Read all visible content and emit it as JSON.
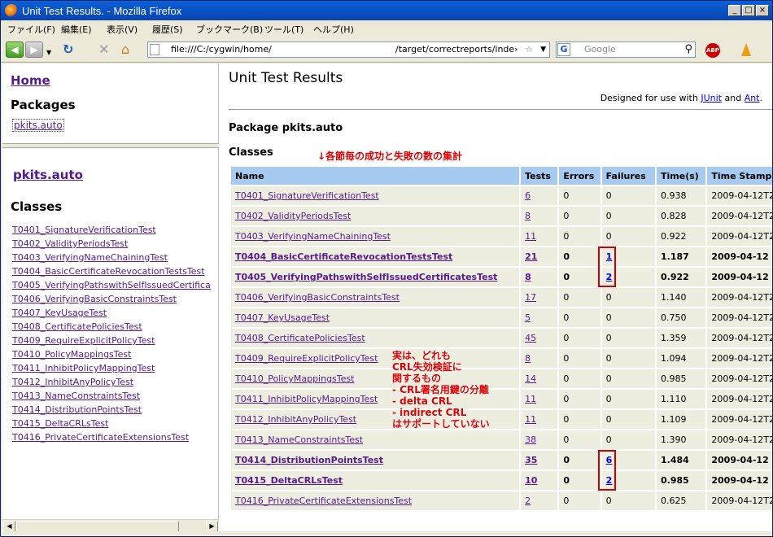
{
  "window": {
    "title": "Unit Test Results. - Mozilla Firefox"
  },
  "menu": [
    "ファイル(F)",
    "編集(E)",
    "表示(V)",
    "履歴(S)",
    "ブックマーク(B)",
    "ツール(T)",
    "ヘルプ(H)"
  ],
  "toolbar": {
    "url_part1": "file:///C:/cygwin/home/",
    "url_part2": "/target/correctreports/inde›",
    "search_placeholder": "Google",
    "addon_label": "ABP"
  },
  "left": {
    "home": "Home",
    "packages_heading": "Packages",
    "package_link": "pkits.auto",
    "package_title": "pkits.auto",
    "classes_heading": "Classes",
    "classes": [
      "T0401_SignatureVerificationTest",
      "T0402_ValidityPeriodsTest",
      "T0403_VerifyingNameChainingTest",
      "T0404_BasicCertificateRevocationTestsTest",
      "T0405_VerifyingPathswithSelfIssuedCertifica",
      "T0406_VerifyingBasicConstraintsTest",
      "T0407_KeyUsageTest",
      "T0408_CertificatePoliciesTest",
      "T0409_RequireExplicitPolicyTest",
      "T0410_PolicyMappingsTest",
      "T0411_InhibitPolicyMappingTest",
      "T0412_InhibitAnyPolicyTest",
      "T0413_NameConstraintsTest",
      "T0414_DistributionPointsTest",
      "T0415_DeltaCRLsTest",
      "T0416_PrivateCertificateExtensionsTest"
    ]
  },
  "main": {
    "title": "Unit Test Results",
    "designed_prefix": "Designed for use with ",
    "designed_junit": "JUnit",
    "designed_and": " and ",
    "designed_ant": "Ant",
    "designed_suffix": ".",
    "package_heading": "Package pkits.auto",
    "classes_heading": "Classes",
    "annotation_top": "↓各節毎の成功と失敗の数の集計",
    "annotation_note": [
      "実は、どれも",
      "CRL失効検証に",
      "関するもの",
      "- CRL署名用鍵の分離",
      "- delta CRL",
      "- indirect CRL",
      "はサポートしていない"
    ],
    "table": {
      "headers": [
        "Name",
        "Tests",
        "Errors",
        "Failures",
        "Time(s)",
        "Time Stamp"
      ],
      "rows": [
        {
          "name": "T0401_SignatureVerificationTest",
          "tests": "6",
          "errors": "0",
          "failures": "0",
          "time": "0.938",
          "stamp": "2009-04-12T2",
          "fail": false
        },
        {
          "name": "T0402_ValidityPeriodsTest",
          "tests": "8",
          "errors": "0",
          "failures": "0",
          "time": "0.828",
          "stamp": "2009-04-12T2",
          "fail": false
        },
        {
          "name": "T0403_VerifyingNameChainingTest",
          "tests": "11",
          "errors": "0",
          "failures": "0",
          "time": "0.922",
          "stamp": "2009-04-12T2",
          "fail": false
        },
        {
          "name": "T0404_BasicCertificateRevocationTestsTest",
          "tests": "21",
          "errors": "0",
          "failures": "1",
          "time": "1.187",
          "stamp": "2009-04-12",
          "fail": true
        },
        {
          "name": "T0405_VerifyingPathswithSelfIssuedCertificatesTest",
          "tests": "8",
          "errors": "0",
          "failures": "2",
          "time": "0.922",
          "stamp": "2009-04-12",
          "fail": true
        },
        {
          "name": "T0406_VerifyingBasicConstraintsTest",
          "tests": "17",
          "errors": "0",
          "failures": "0",
          "time": "1.140",
          "stamp": "2009-04-12T2",
          "fail": false
        },
        {
          "name": "T0407_KeyUsageTest",
          "tests": "5",
          "errors": "0",
          "failures": "0",
          "time": "0.750",
          "stamp": "2009-04-12T2",
          "fail": false
        },
        {
          "name": "T0408_CertificatePoliciesTest",
          "tests": "45",
          "errors": "0",
          "failures": "0",
          "time": "1.359",
          "stamp": "2009-04-12T2",
          "fail": false
        },
        {
          "name": "T0409_RequireExplicitPolicyTest",
          "tests": "8",
          "errors": "0",
          "failures": "0",
          "time": "1.094",
          "stamp": "2009-04-12T2",
          "fail": false
        },
        {
          "name": "T0410_PolicyMappingsTest",
          "tests": "14",
          "errors": "0",
          "failures": "0",
          "time": "0.985",
          "stamp": "2009-04-12T2",
          "fail": false
        },
        {
          "name": "T0411_InhibitPolicyMappingTest",
          "tests": "11",
          "errors": "0",
          "failures": "0",
          "time": "1.110",
          "stamp": "2009-04-12T2",
          "fail": false
        },
        {
          "name": "T0412_InhibitAnyPolicyTest",
          "tests": "11",
          "errors": "0",
          "failures": "0",
          "time": "1.109",
          "stamp": "2009-04-12T2",
          "fail": false
        },
        {
          "name": "T0413_NameConstraintsTest",
          "tests": "38",
          "errors": "0",
          "failures": "0",
          "time": "1.390",
          "stamp": "2009-04-12T2",
          "fail": false
        },
        {
          "name": "T0414_DistributionPointsTest",
          "tests": "35",
          "errors": "0",
          "failures": "6",
          "time": "1.484",
          "stamp": "2009-04-12",
          "fail": true
        },
        {
          "name": "T0415_DeltaCRLsTest",
          "tests": "10",
          "errors": "0",
          "failures": "2",
          "time": "0.985",
          "stamp": "2009-04-12",
          "fail": true
        },
        {
          "name": "T0416_PrivateCertificateExtensionsTest",
          "tests": "2",
          "errors": "0",
          "failures": "0",
          "time": "0.625",
          "stamp": "2009-04-12T2",
          "fail": false
        }
      ]
    }
  }
}
